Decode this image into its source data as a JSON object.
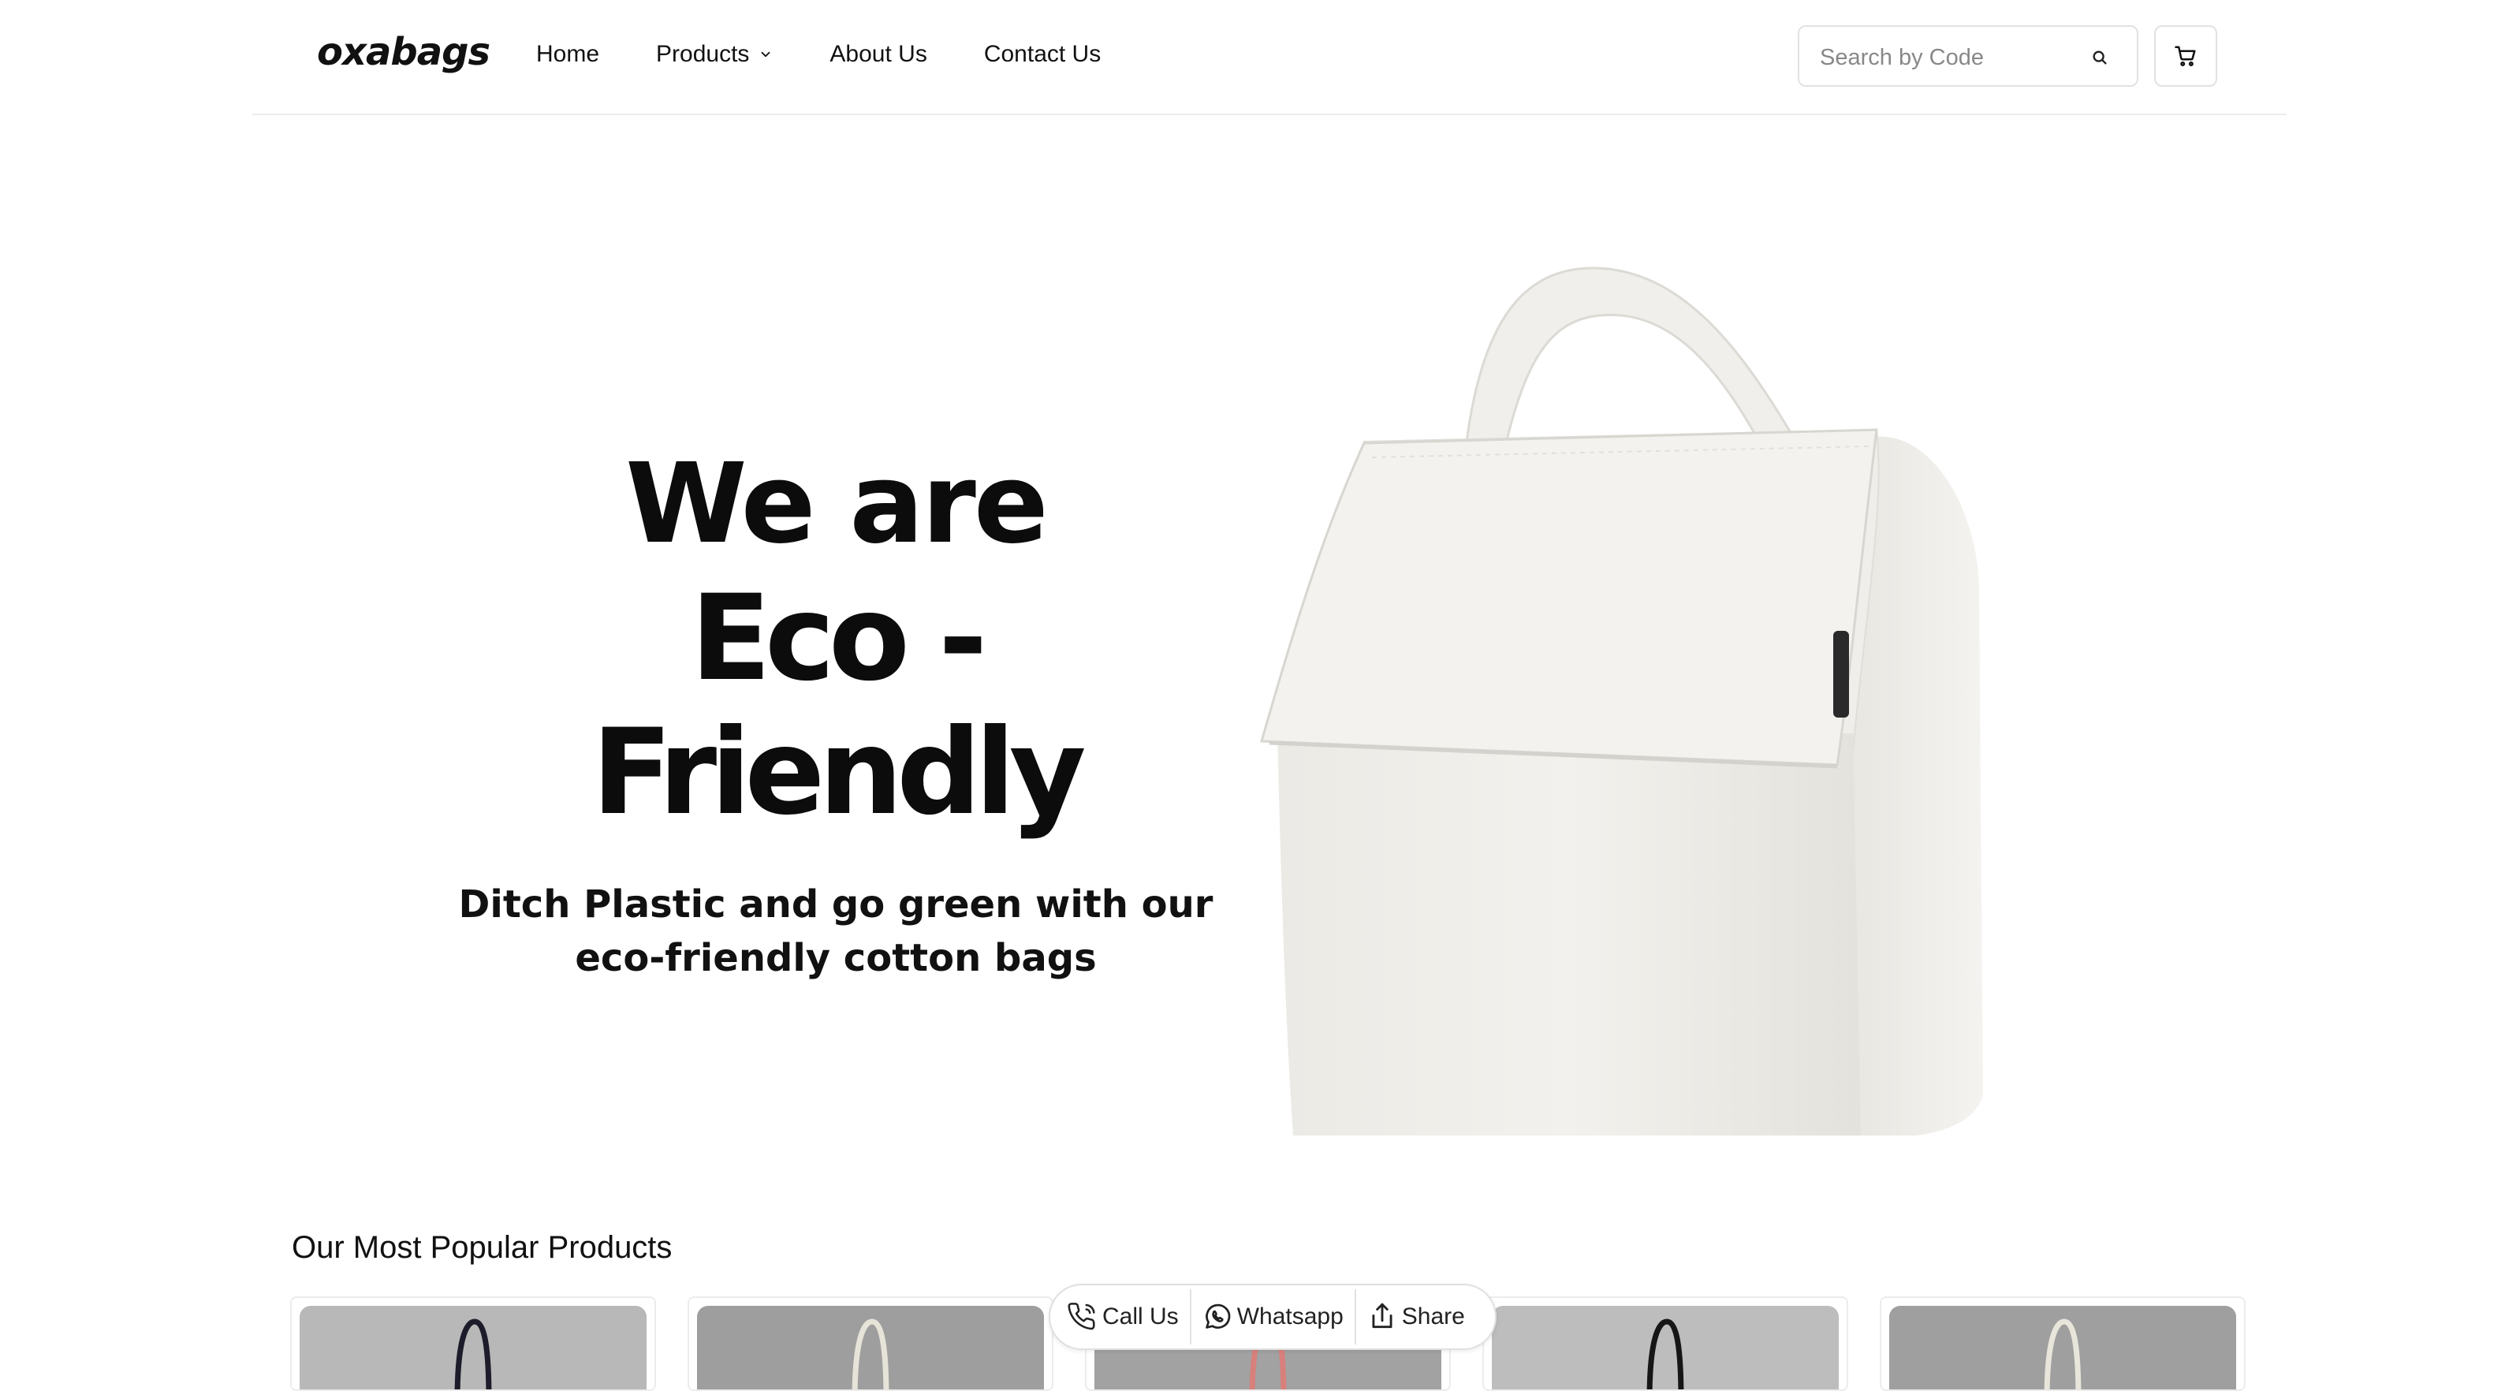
{
  "header": {
    "logo": "oxabags",
    "nav": [
      {
        "label": "Home"
      },
      {
        "label": "Products"
      },
      {
        "label": "About Us"
      },
      {
        "label": "Contact Us"
      }
    ],
    "search": {
      "placeholder": "Search by Code",
      "value": ""
    },
    "icons": {
      "search": "search-icon",
      "cart": "cart-icon",
      "dropdown": "chevron-down-icon"
    }
  },
  "hero": {
    "line1": "We are",
    "line2": "Eco - Friendly",
    "subtitle_line1": "Ditch Plastic and go green with our",
    "subtitle_line2": "eco-friendly cotton bags"
  },
  "popular": {
    "title": "Our Most Popular Products",
    "products": [
      {
        "thumb_bg": "#b8b8b8",
        "bag_color": "#eeeeea",
        "handle_color": "#1c1c2a"
      },
      {
        "thumb_bg": "#9e9e9e",
        "bag_color": "#eeeeea",
        "handle_color": "#e6e3d8"
      },
      {
        "thumb_bg": "#a2a2a2",
        "bag_color": "#eeeeea",
        "handle_color": "#d8807c"
      },
      {
        "thumb_bg": "#bdbdbd",
        "bag_color": "#eeeeea",
        "handle_color": "#161616"
      },
      {
        "thumb_bg": "#9f9f9f",
        "bag_color": "#eeeeea",
        "handle_color": "#e8e5da"
      }
    ]
  },
  "contact_bar": {
    "call": "Call Us",
    "whatsapp": "Whatsapp",
    "share": "Share",
    "icons": {
      "call": "phone-icon",
      "whatsapp": "whatsapp-icon",
      "share": "share-icon"
    }
  }
}
